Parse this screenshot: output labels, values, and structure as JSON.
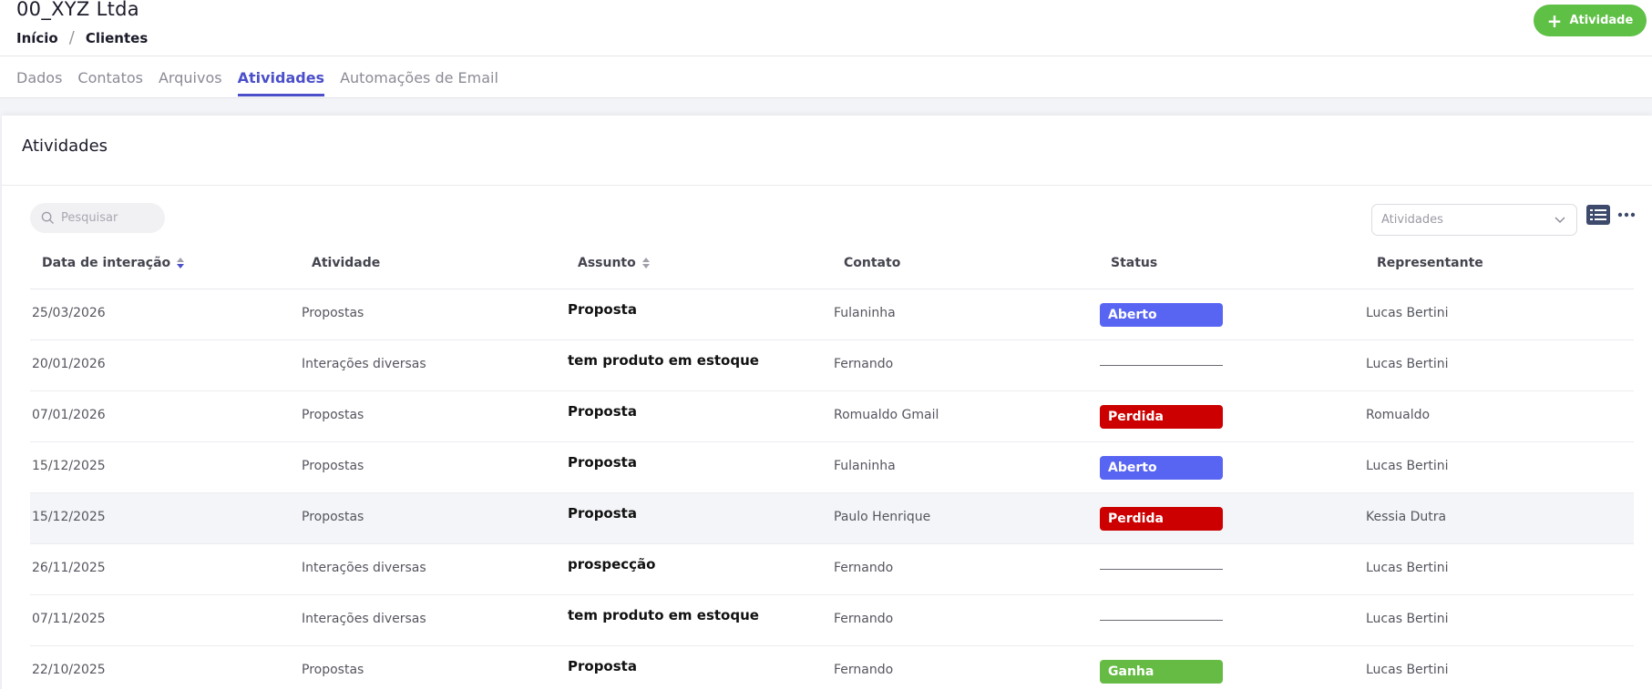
{
  "header": {
    "company": "00_XYZ Ltda",
    "breadcrumb": [
      "Início",
      "Clientes"
    ],
    "breadcrumb_separator": "/",
    "add_button_label": "Atividade"
  },
  "tabs": [
    {
      "label": "Dados",
      "active": false
    },
    {
      "label": "Contatos",
      "active": false
    },
    {
      "label": "Arquivos",
      "active": false
    },
    {
      "label": "Atividades",
      "active": true
    },
    {
      "label": "Automações de Email",
      "active": false
    }
  ],
  "card": {
    "title": "Atividades",
    "search_placeholder": "Pesquisar",
    "filter_placeholder": "Atividades"
  },
  "table": {
    "columns": [
      "Data de interação",
      "Atividade",
      "Assunto",
      "Contato",
      "Status",
      "Representante"
    ],
    "rows": [
      {
        "date": "25/03/2026",
        "activity": "Propostas",
        "subject": "Proposta",
        "contact": "Fulaninha",
        "status": "Aberto",
        "rep": "Lucas Bertini"
      },
      {
        "date": "20/01/2026",
        "activity": "Interações diversas",
        "subject": "tem produto em estoque",
        "contact": "Fernando",
        "status": "",
        "rep": "Lucas Bertini"
      },
      {
        "date": "07/01/2026",
        "activity": "Propostas",
        "subject": "Proposta",
        "contact": "Romualdo Gmail",
        "status": "Perdida",
        "rep": "Romualdo"
      },
      {
        "date": "15/12/2025",
        "activity": "Propostas",
        "subject": "Proposta",
        "contact": "Fulaninha",
        "status": "Aberto",
        "rep": "Lucas Bertini"
      },
      {
        "date": "15/12/2025",
        "activity": "Propostas",
        "subject": "Proposta",
        "contact": "Paulo Henrique",
        "status": "Perdida",
        "rep": "Kessia Dutra"
      },
      {
        "date": "26/11/2025",
        "activity": "Interações diversas",
        "subject": "prospecção",
        "contact": "Fernando",
        "status": "",
        "rep": "Lucas Bertini"
      },
      {
        "date": "07/11/2025",
        "activity": "Interações diversas",
        "subject": "tem produto em estoque",
        "contact": "Fernando",
        "status": "",
        "rep": "Lucas Bertini"
      },
      {
        "date": "22/10/2025",
        "activity": "Propostas",
        "subject": "Proposta",
        "contact": "Fernando",
        "status": "Ganha",
        "rep": "Lucas Bertini"
      }
    ]
  },
  "colors": {
    "accent": "#4b4fc9",
    "add_button": "#5fc046",
    "status_aberto": "#5865f2",
    "status_perdida": "#cc0000",
    "status_ganha": "#66bb44"
  }
}
